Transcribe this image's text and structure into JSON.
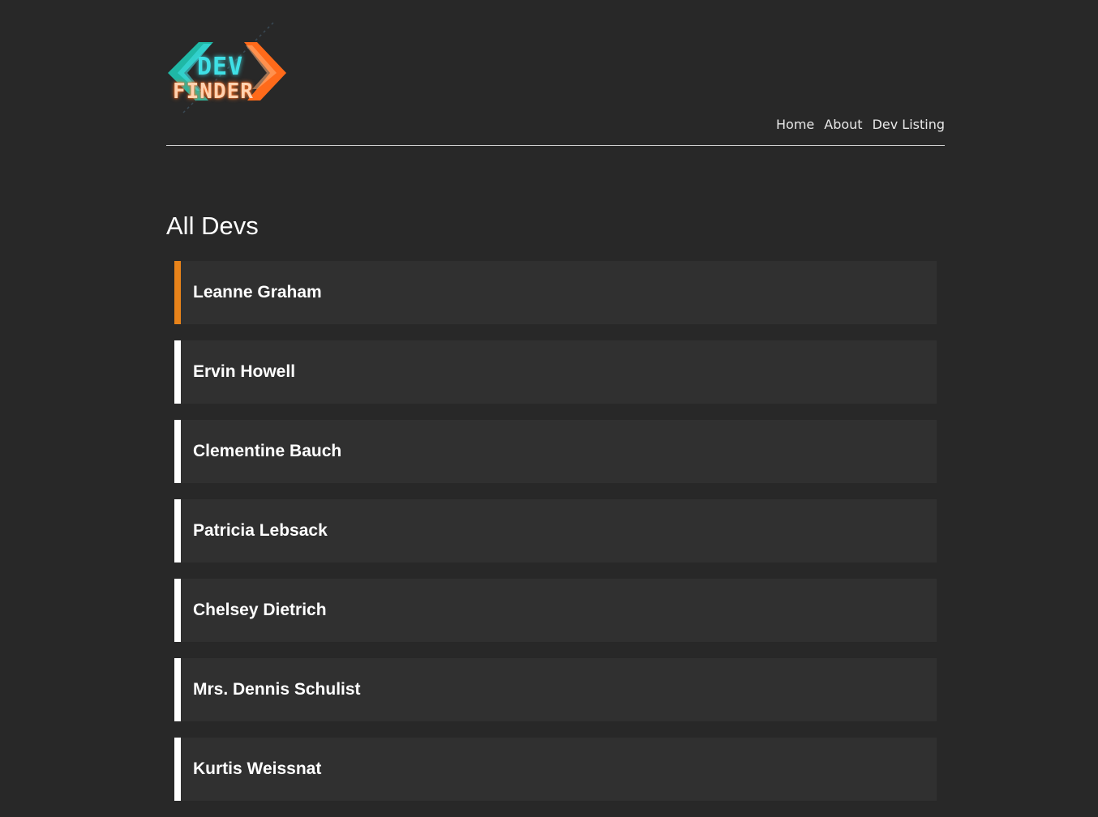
{
  "header": {
    "logo": {
      "line1": "DEV",
      "line2": "FINDER",
      "colors": {
        "left_chevron": "#1fb8a6",
        "right_chevron": "#ff6a1a",
        "dev_text": "#3fe0e6",
        "finder_text": "#ffd2b0"
      }
    },
    "nav": [
      {
        "label": "Home"
      },
      {
        "label": "About"
      },
      {
        "label": "Dev Listing"
      }
    ]
  },
  "main": {
    "title": "All Devs",
    "devs": [
      {
        "name": "Leanne Graham",
        "active": true
      },
      {
        "name": "Ervin Howell",
        "active": false
      },
      {
        "name": "Clementine Bauch",
        "active": false
      },
      {
        "name": "Patricia Lebsack",
        "active": false
      },
      {
        "name": "Chelsey Dietrich",
        "active": false
      },
      {
        "name": "Mrs. Dennis Schulist",
        "active": false
      },
      {
        "name": "Kurtis Weissnat",
        "active": false
      }
    ]
  },
  "colors": {
    "background": "#282828",
    "card": "#303030",
    "accent_active": "#e8831a",
    "accent_default": "#ffffff"
  }
}
